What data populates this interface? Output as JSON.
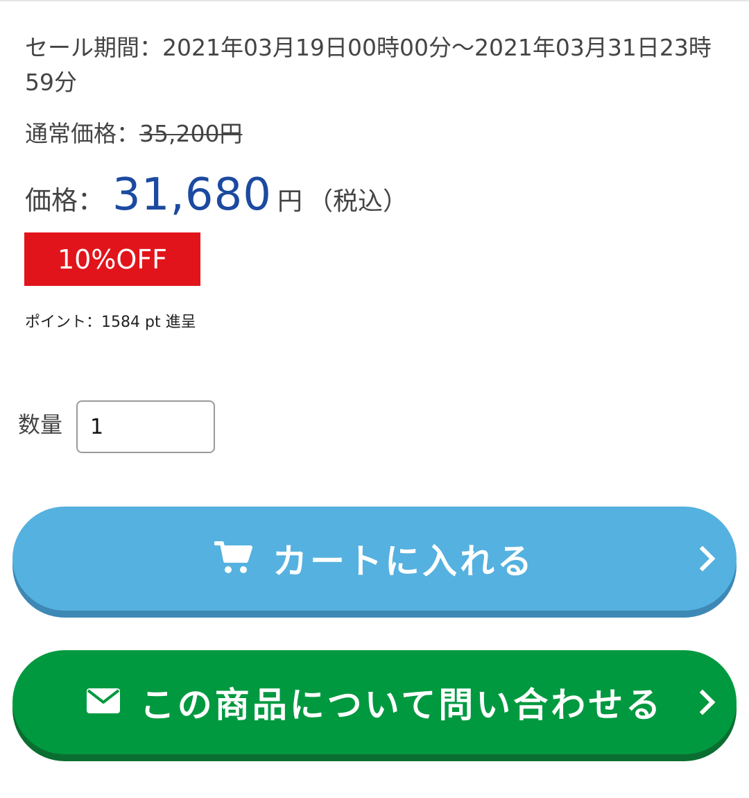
{
  "sale": {
    "label": "セール期間：",
    "period": "2021年03月19日00時00分〜2021年03月31日23時59分"
  },
  "regular_price": {
    "label": "通常価格：",
    "value": "35,200円"
  },
  "price": {
    "label": "価格：",
    "value": "31,680",
    "unit": "円",
    "tax_note": "（税込）",
    "value_color": "#1c4aa0"
  },
  "discount_badge": {
    "text": "10%OFF",
    "color": "#e2141b"
  },
  "points": {
    "text": "ポイント：1584 pt 進呈"
  },
  "quantity": {
    "label": "数量",
    "value": "1"
  },
  "cart_button": {
    "label": "カートに入れる",
    "icon": "cart-icon",
    "color": "#55b1df"
  },
  "contact_button": {
    "label": "この商品について問い合わせる",
    "icon": "mail-icon",
    "color": "#00993f"
  }
}
